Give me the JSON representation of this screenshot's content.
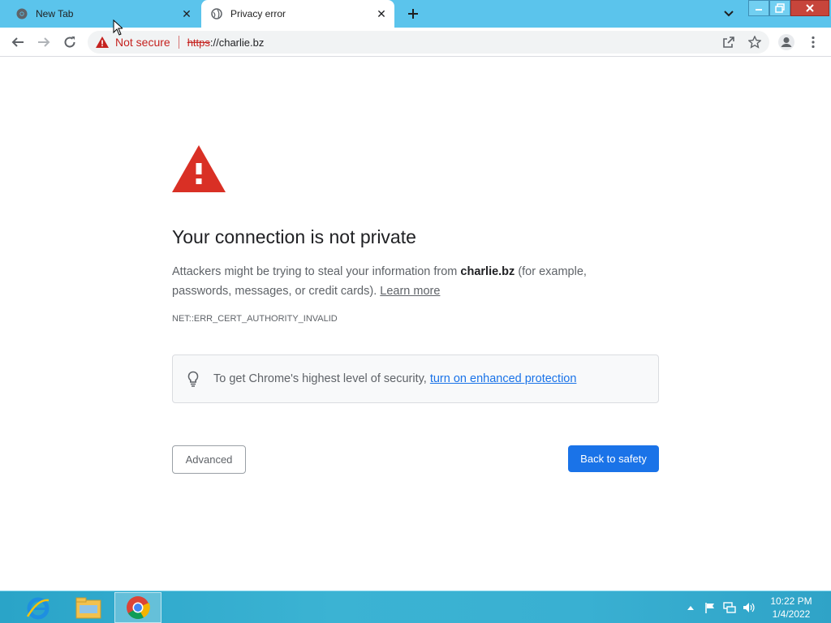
{
  "tabs": [
    {
      "title": "New Tab",
      "active": false,
      "favicon": "chrome-icon"
    },
    {
      "title": "Privacy error",
      "active": true,
      "favicon": "globe-icon"
    }
  ],
  "omnibox": {
    "security_label": "Not secure",
    "url_scheme": "https",
    "url_rest": "://charlie.bz"
  },
  "page": {
    "heading": "Your connection is not private",
    "explain_prefix": "Attackers might be trying to steal your information from ",
    "domain": "charlie.bz",
    "explain_suffix": " (for example, passwords, messages, or credit cards).",
    "learn_more": "Learn more",
    "error_code": "NET::ERR_CERT_AUTHORITY_INVALID",
    "enhanced_prefix": "To get Chrome's highest level of security, ",
    "enhanced_link": "turn on enhanced protection",
    "advanced_button": "Advanced",
    "safety_button": "Back to safety"
  },
  "taskbar": {
    "items": [
      "internet-explorer-icon",
      "file-explorer-icon",
      "chrome-icon"
    ],
    "time": "10:22 PM",
    "date": "1/4/2022"
  },
  "colors": {
    "tabstrip": "#5bc4ec",
    "warning_red": "#d93025",
    "primary_blue": "#1a73e8"
  }
}
